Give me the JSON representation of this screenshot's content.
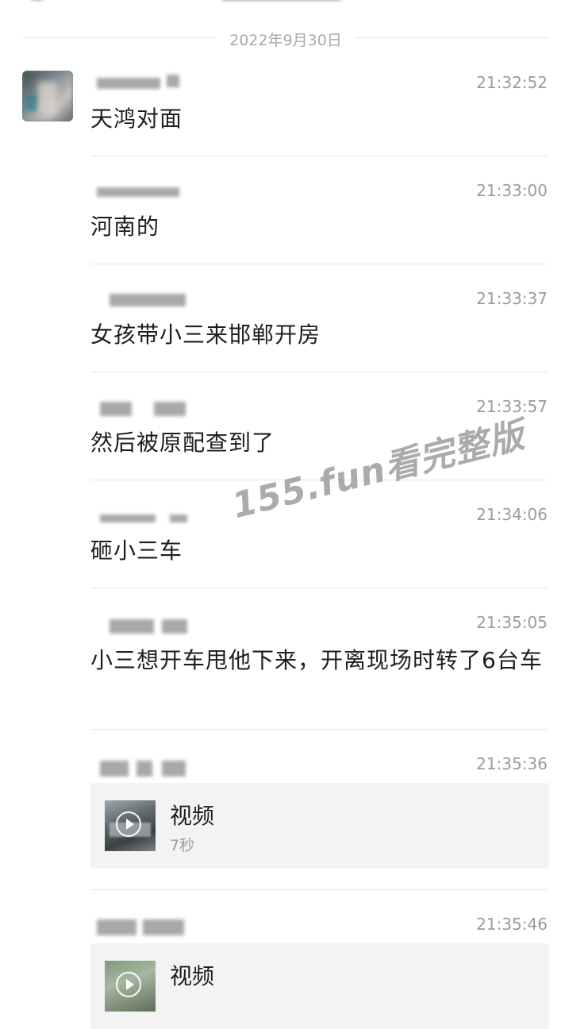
{
  "date_separator": "2022年9月30日",
  "messages": [
    {
      "time": "21:32:52",
      "text": "天鸿对面"
    },
    {
      "time": "21:33:00",
      "text": "河南的"
    },
    {
      "time": "21:33:37",
      "text": "女孩带小三来邯郸开房"
    },
    {
      "time": "21:33:57",
      "text": "然后被原配查到了"
    },
    {
      "time": "21:34:06",
      "text": "砸小三车"
    },
    {
      "time": "21:35:05",
      "text": "小三想开车甩他下来，开离现场时转了6台车"
    },
    {
      "time": "21:35:36",
      "video": {
        "title": "视频",
        "duration": "7秒"
      }
    },
    {
      "time": "21:35:46",
      "video": {
        "title": "视频"
      }
    }
  ],
  "watermark": "155.fun看完整版",
  "icons": {
    "play": "play-circle-icon",
    "avatar": "user-avatar"
  }
}
